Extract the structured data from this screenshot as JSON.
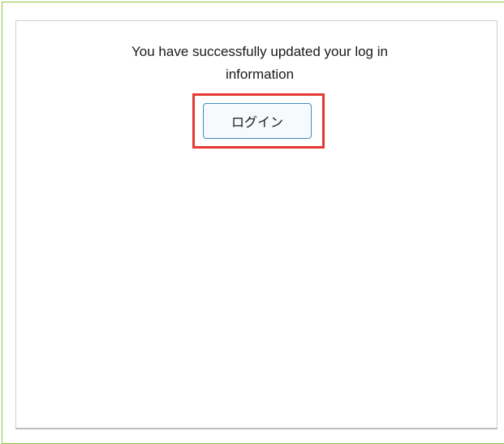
{
  "dialog": {
    "message": "You have successfully updated your log in information",
    "login_button_label": "ログイン"
  },
  "colors": {
    "outer_frame_border": "#8dc63f",
    "panel_border": "#cfcfcf",
    "highlight_border": "#e53935",
    "button_border": "#3a8fc4",
    "text": "#1a1a1a"
  }
}
